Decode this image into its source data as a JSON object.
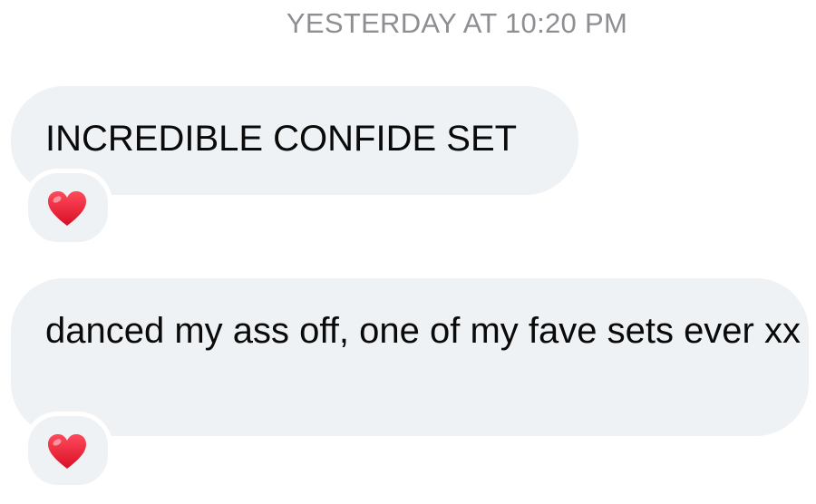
{
  "conversation": {
    "timestamp": "YESTERDAY AT 10:20 PM",
    "messages": [
      {
        "text": "INCREDIBLE CONFIDE SET",
        "reaction_icon": "red-heart-icon"
      },
      {
        "text": "danced my ass off, one of my fave sets ever xx",
        "reaction_icon": "red-heart-icon"
      }
    ]
  },
  "colors": {
    "bubble_background": "#eff2f4",
    "timestamp_text": "#8e8e93",
    "message_text": "#0a0a0a",
    "heart": "#e0142f"
  }
}
